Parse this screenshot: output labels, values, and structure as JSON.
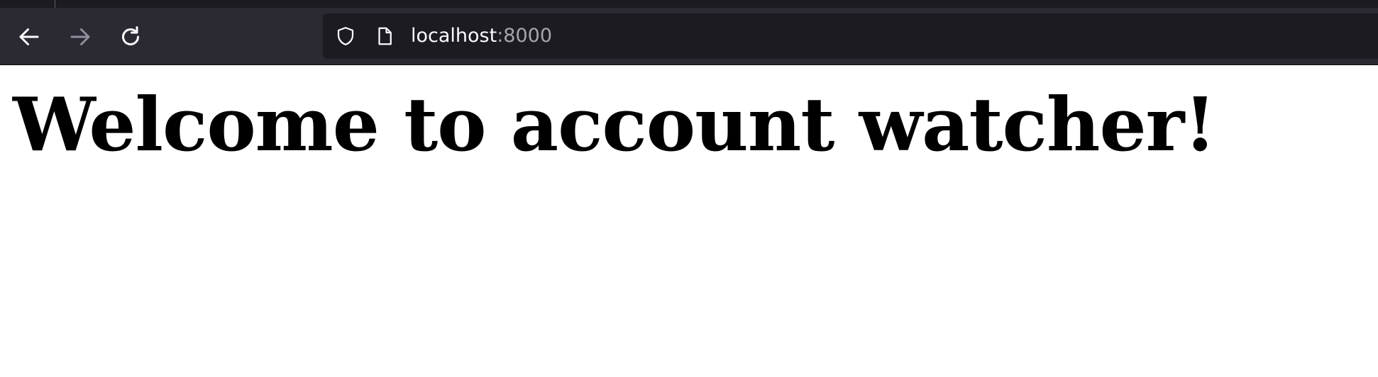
{
  "browser": {
    "address_bar": {
      "host": "localhost",
      "port": ":8000"
    },
    "icons": {
      "back": "arrow-left-icon",
      "forward": "arrow-right-icon",
      "reload": "reload-icon",
      "security": "shield-icon",
      "page": "page-icon"
    },
    "colors": {
      "toolbar": "#2b2a33",
      "urlbar": "#1c1b22",
      "icon": "#fbfbfe",
      "icon_disabled": "#8f8f9d"
    }
  },
  "page": {
    "heading": "Welcome to account watcher!"
  }
}
